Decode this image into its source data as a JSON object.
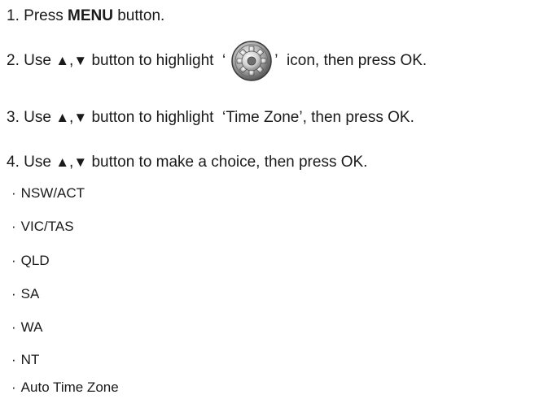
{
  "steps": [
    {
      "num": "1.",
      "pre": "Press",
      "bold": "MENU",
      "post": "button."
    },
    {
      "num": "2.",
      "pre": "Use",
      "up": "▲",
      "comma": ",",
      "down": "▼",
      "mid": "button to highlight",
      "open_quote": "‘",
      "icon": "settings-gear-icon",
      "close_quote": "’",
      "post": "icon, then press OK."
    },
    {
      "num": "3.",
      "pre": "Use",
      "up": "▲",
      "comma": ",",
      "down": "▼",
      "mid": "button to highlight",
      "quoted": "‘Time Zone’",
      "post": ", then press OK."
    },
    {
      "num": "4.",
      "pre": "Use",
      "up": "▲",
      "comma": ",",
      "down": "▼",
      "post": "button to make a choice, then press OK."
    }
  ],
  "options": [
    "NSW/ACT",
    "VIC/TAS",
    "QLD",
    "SA",
    "WA",
    "NT",
    "Auto Time Zone"
  ],
  "bullet": "·"
}
